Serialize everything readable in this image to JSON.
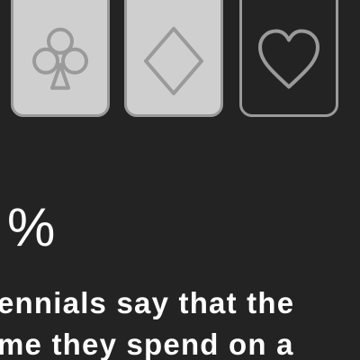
{
  "cards": [
    {
      "suit": "clubs",
      "icon": "club-icon",
      "style": "light"
    },
    {
      "suit": "diamonds",
      "icon": "diamond-icon",
      "style": "light"
    },
    {
      "suit": "hearts",
      "icon": "heart-icon",
      "style": "dark"
    }
  ],
  "stat": {
    "value": "%"
  },
  "caption": {
    "line1": "ennials say that the",
    "line2": "me they spend on a"
  },
  "colors": {
    "background": "#232323",
    "card_fill": "#cfcfcf",
    "card_outline": "#9a9a9a",
    "text": "#ffffff"
  }
}
